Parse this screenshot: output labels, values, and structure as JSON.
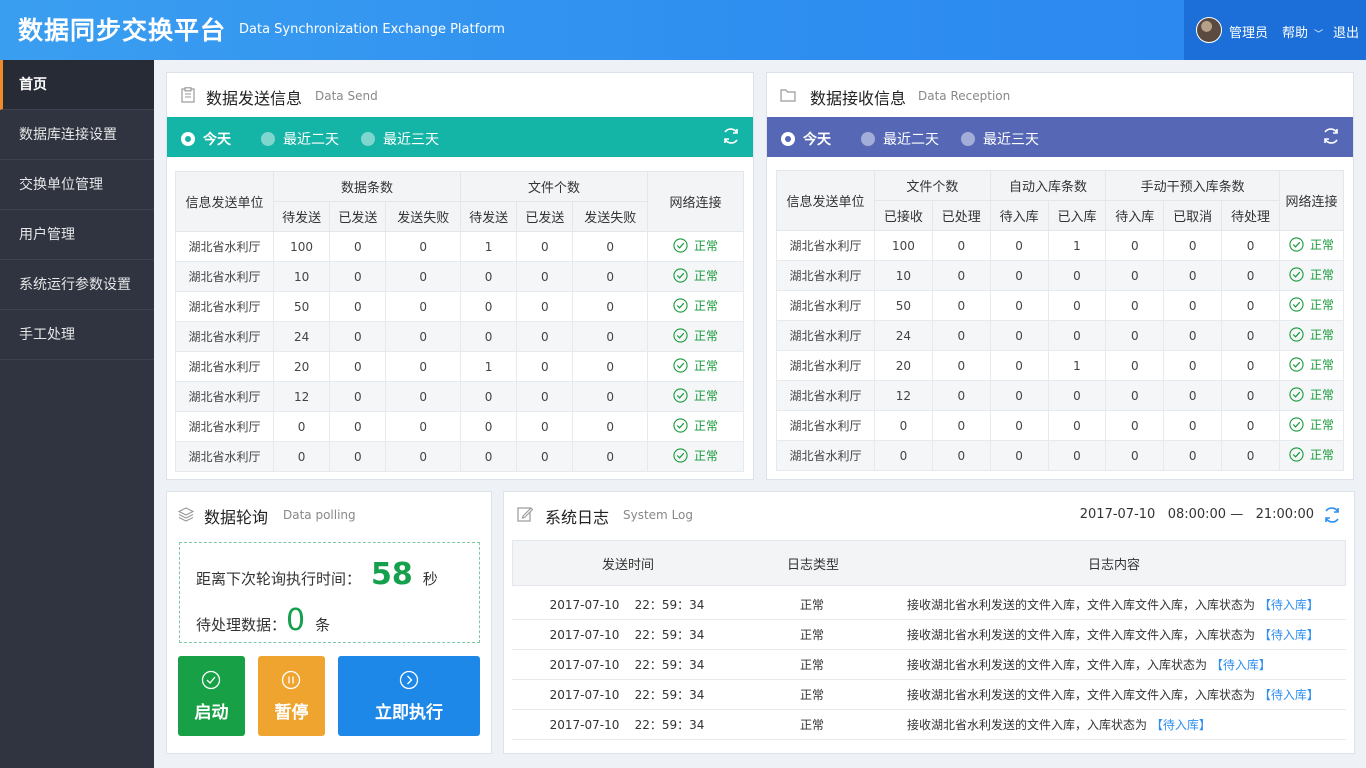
{
  "header": {
    "title": "数据同步交换平台",
    "subtitle": "Data Synchronization Exchange Platform",
    "user": "管理员",
    "help": "帮助",
    "logout": "退出"
  },
  "sidebar": {
    "items": [
      {
        "label": "首页"
      },
      {
        "label": "数据库连接设置"
      },
      {
        "label": "交换单位管理"
      },
      {
        "label": "用户管理"
      },
      {
        "label": "系统运行参数设置"
      },
      {
        "label": "手工处理"
      }
    ]
  },
  "send": {
    "title": "数据发送信息",
    "subtitle": "Data Send",
    "filters": [
      "今天",
      "最近二天",
      "最近三天"
    ],
    "headers": {
      "unit": "信息发送单位",
      "data_group": "数据条数",
      "file_group": "文件个数",
      "network": "网络连接",
      "pending": "待发送",
      "sent": "已发送",
      "failed": "发送失败"
    },
    "rows": [
      [
        "湖北省水利厅",
        "100",
        "0",
        "0",
        "1",
        "0",
        "0",
        "正常"
      ],
      [
        "湖北省水利厅",
        "10",
        "0",
        "0",
        "0",
        "0",
        "0",
        "正常"
      ],
      [
        "湖北省水利厅",
        "50",
        "0",
        "0",
        "0",
        "0",
        "0",
        "正常"
      ],
      [
        "湖北省水利厅",
        "24",
        "0",
        "0",
        "0",
        "0",
        "0",
        "正常"
      ],
      [
        "湖北省水利厅",
        "20",
        "0",
        "0",
        "1",
        "0",
        "0",
        "正常"
      ],
      [
        "湖北省水利厅",
        "12",
        "0",
        "0",
        "0",
        "0",
        "0",
        "正常"
      ],
      [
        "湖北省水利厅",
        "0",
        "0",
        "0",
        "0",
        "0",
        "0",
        "正常"
      ],
      [
        "湖北省水利厅",
        "0",
        "0",
        "0",
        "0",
        "0",
        "0",
        "正常"
      ]
    ]
  },
  "receive": {
    "title": "数据接收信息",
    "subtitle": "Data Reception",
    "filters": [
      "今天",
      "最近二天",
      "最近三天"
    ],
    "headers": {
      "unit": "信息发送单位",
      "file_group": "文件个数",
      "auto_group": "自动入库条数",
      "manual_group": "手动干预入库条数",
      "network": "网络连接",
      "received": "已接收",
      "processed": "已处理",
      "to_store": "待入库",
      "stored": "已入库",
      "cancelled": "已取消",
      "to_process": "待处理"
    },
    "rows": [
      [
        "湖北省水利厅",
        "100",
        "0",
        "0",
        "1",
        "0",
        "0",
        "0",
        "正常"
      ],
      [
        "湖北省水利厅",
        "10",
        "0",
        "0",
        "0",
        "0",
        "0",
        "0",
        "正常"
      ],
      [
        "湖北省水利厅",
        "50",
        "0",
        "0",
        "0",
        "0",
        "0",
        "0",
        "正常"
      ],
      [
        "湖北省水利厅",
        "24",
        "0",
        "0",
        "0",
        "0",
        "0",
        "0",
        "正常"
      ],
      [
        "湖北省水利厅",
        "20",
        "0",
        "0",
        "1",
        "0",
        "0",
        "0",
        "正常"
      ],
      [
        "湖北省水利厅",
        "12",
        "0",
        "0",
        "0",
        "0",
        "0",
        "0",
        "正常"
      ],
      [
        "湖北省水利厅",
        "0",
        "0",
        "0",
        "0",
        "0",
        "0",
        "0",
        "正常"
      ],
      [
        "湖北省水利厅",
        "0",
        "0",
        "0",
        "0",
        "0",
        "0",
        "0",
        "正常"
      ]
    ]
  },
  "polling": {
    "title": "数据轮询",
    "subtitle": "Data polling",
    "countdown_label": "距离下次轮询执行时间：",
    "countdown_value": "58",
    "countdown_unit": "秒",
    "pending_label": "待处理数据：",
    "pending_value": "0",
    "pending_unit": "条",
    "start_label": "启动",
    "pause_label": "暂停",
    "run_label": "立即执行"
  },
  "log": {
    "title": "系统日志",
    "subtitle": "System Log",
    "range": "2017-07-10   08:00:00 —   21:00:00",
    "headers": [
      "发送时间",
      "日志类型",
      "日志内容"
    ],
    "rows": [
      {
        "time": "2017-07-10    22：59：34",
        "type": "正常",
        "content": "接收湖北省水利发送的文件入库，文件入库文件入库，入库状态为",
        "status": "【待入库】"
      },
      {
        "time": "2017-07-10    22：59：34",
        "type": "正常",
        "content": "接收湖北省水利发送的文件入库，文件入库文件入库，入库状态为",
        "status": "【待入库】"
      },
      {
        "time": "2017-07-10    22：59：34",
        "type": "正常",
        "content": "接收湖北省水利发送的文件入库，文件入库，入库状态为",
        "status": "【待入库】"
      },
      {
        "time": "2017-07-10    22：59：34",
        "type": "正常",
        "content": "接收湖北省水利发送的文件入库，文件入库文件入库，入库状态为",
        "status": "【待入库】"
      },
      {
        "time": "2017-07-10    22：59：34",
        "type": "正常",
        "content": "接收湖北省水利发送的文件入库，入库状态为",
        "status": "【待入库】"
      }
    ]
  },
  "colors": {
    "send_bar": "#14b4a6",
    "receive_bar": "#5567b5",
    "ok_green": "#1a9b3c",
    "start": "#17a046",
    "pause": "#f0a430",
    "run": "#1e88e8"
  }
}
